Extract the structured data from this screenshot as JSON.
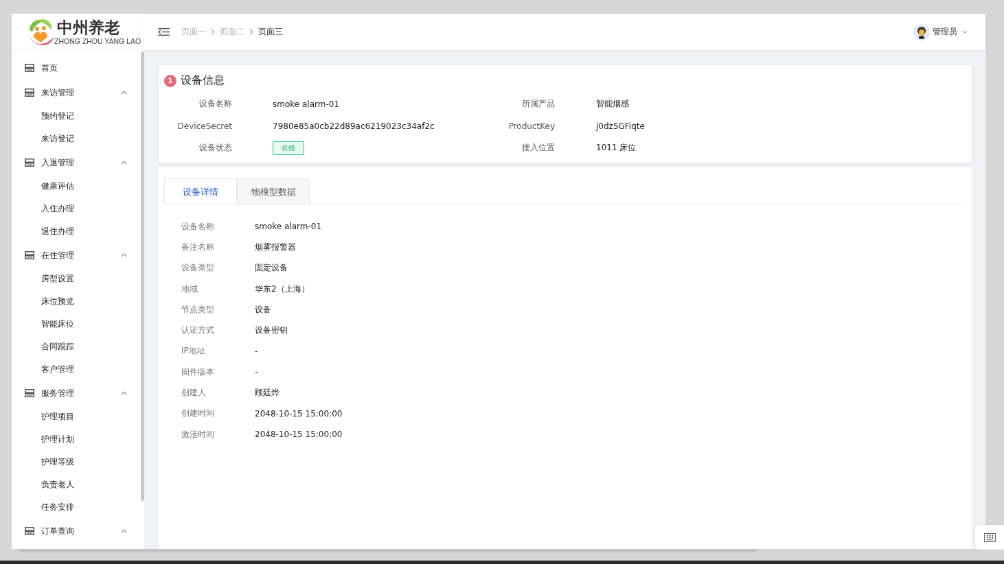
{
  "logo": {
    "title": "中州养老",
    "subtitle": "ZHONG ZHOU YANG LAO"
  },
  "breadcrumb": [
    "页面一",
    "页面二",
    "页面三"
  ],
  "user": {
    "name": "管理员"
  },
  "sidebar": {
    "items": [
      {
        "label": "首页"
      },
      {
        "label": "来访管理",
        "expanded": true,
        "children": [
          {
            "label": "预约登记"
          },
          {
            "label": "来访登记"
          }
        ]
      },
      {
        "label": "入退管理",
        "expanded": true,
        "children": [
          {
            "label": "健康评估"
          },
          {
            "label": "入住办理"
          },
          {
            "label": "退住办理"
          }
        ]
      },
      {
        "label": "在住管理",
        "expanded": true,
        "children": [
          {
            "label": "房型设置"
          },
          {
            "label": "床位预览"
          },
          {
            "label": "智能床位"
          },
          {
            "label": "合同跟踪"
          },
          {
            "label": "客户管理"
          }
        ]
      },
      {
        "label": "服务管理",
        "expanded": true,
        "children": [
          {
            "label": "护理项目"
          },
          {
            "label": "护理计划"
          },
          {
            "label": "护理等级"
          },
          {
            "label": "负责老人"
          },
          {
            "label": "任务安排"
          }
        ]
      },
      {
        "label": "订单查询",
        "expanded": true
      }
    ]
  },
  "device_info": {
    "step": "1",
    "title": "设备信息",
    "fields": [
      {
        "label": "设备名称",
        "value": "smoke alarm-01",
        "kind": "text"
      },
      {
        "label": "所属产品",
        "value": "智能烟感",
        "kind": "text"
      },
      {
        "label": "DeviceSecret",
        "value": "7980e85a0cb22d89ac6219023c34af2c",
        "kind": "text"
      },
      {
        "label": "ProductKey",
        "value": "j0dz5GFiqte",
        "kind": "text"
      },
      {
        "label": "设备状态",
        "value": "在线",
        "kind": "status"
      },
      {
        "label": "接入位置",
        "value": "1011 床位",
        "kind": "text"
      }
    ]
  },
  "tabs": [
    {
      "label": "设备详情",
      "selected": true
    },
    {
      "label": "物模型数据",
      "selected": false
    }
  ],
  "details": [
    {
      "label": "设备名称",
      "value": "smoke alarm-01"
    },
    {
      "label": "备注名称",
      "value": "烟雾报警器"
    },
    {
      "label": "设备类型",
      "value": "固定设备"
    },
    {
      "label": "地域",
      "value": "华东2（上海）"
    },
    {
      "label": "节点类型",
      "value": "设备"
    },
    {
      "label": "认证方式",
      "value": "设备密钥"
    },
    {
      "label": "IP地址",
      "value": "-"
    },
    {
      "label": "固件版本",
      "value": "-"
    },
    {
      "label": "创建人",
      "value": "顾廷烨"
    },
    {
      "label": "创建时间",
      "value": "2048-10-15 15:00:00"
    },
    {
      "label": "激活时间",
      "value": "2048-10-15 15:00:00"
    }
  ]
}
